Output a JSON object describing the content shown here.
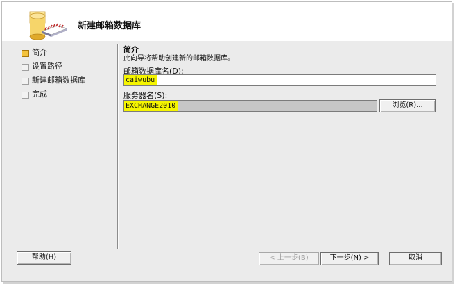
{
  "header": {
    "title": "新建邮箱数据库",
    "icon": "database-wizard-icon"
  },
  "nav": {
    "items": [
      {
        "label": "简介",
        "active": true
      },
      {
        "label": "设置路径",
        "active": false
      },
      {
        "label": "新建邮箱数据库",
        "active": false
      },
      {
        "label": "完成",
        "active": false
      }
    ]
  },
  "content": {
    "section_title": "简介",
    "intro": "此向导将帮助创建新的邮箱数据库。",
    "db_name_label": "邮箱数据库名(D):",
    "db_name_value": "caiwubu",
    "server_label": "服务器名(S):",
    "server_value": "EXCHANGE2010",
    "browse_label": "浏览(R)..."
  },
  "footer": {
    "help_label": "帮助(H)",
    "back_label": "< 上一步(B)",
    "next_label": "下一步(N) >",
    "cancel_label": "取消"
  },
  "colors": {
    "highlight": "#f5f500",
    "active_marker": "#f3c23c"
  }
}
